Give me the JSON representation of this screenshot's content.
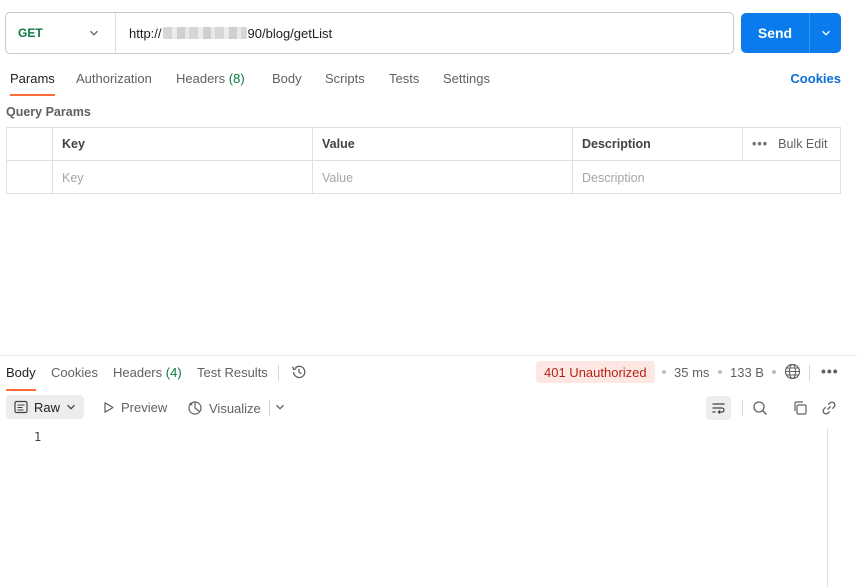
{
  "request": {
    "method": "GET",
    "url_prefix": "http://",
    "url_suffix": "90/blog/getList",
    "send_label": "Send"
  },
  "request_tabs": [
    {
      "label": "Params",
      "count": ""
    },
    {
      "label": "Authorization",
      "count": ""
    },
    {
      "label": "Headers",
      "count": "(8)"
    },
    {
      "label": "Body",
      "count": ""
    },
    {
      "label": "Scripts",
      "count": ""
    },
    {
      "label": "Tests",
      "count": ""
    },
    {
      "label": "Settings",
      "count": ""
    }
  ],
  "cookies_link": "Cookies",
  "query_params": {
    "title": "Query Params",
    "headers": {
      "key": "Key",
      "value": "Value",
      "description": "Description",
      "bulk_edit": "Bulk Edit"
    },
    "placeholders": {
      "key": "Key",
      "value": "Value",
      "description": "Description"
    }
  },
  "response_tabs": [
    {
      "label": "Body",
      "count": ""
    },
    {
      "label": "Cookies",
      "count": ""
    },
    {
      "label": "Headers",
      "count": "(4)"
    },
    {
      "label": "Test Results",
      "count": ""
    }
  ],
  "response_meta": {
    "status": "401 Unauthorized",
    "time": "35 ms",
    "size": "133 B"
  },
  "format_bar": {
    "raw_label": "Raw",
    "preview_label": "Preview",
    "visualize_label": "Visualize"
  },
  "editor": {
    "line_numbers": [
      "1"
    ]
  },
  "colors": {
    "accent": "#ff6c37",
    "send_blue": "#097bed",
    "method_green": "#0b7a3e",
    "status_error_bg": "#fde7e3",
    "status_error_fg": "#b42318"
  }
}
